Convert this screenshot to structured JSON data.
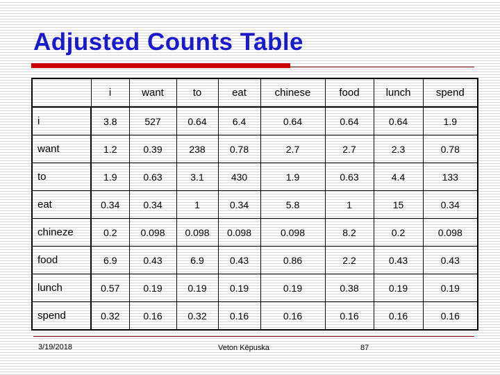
{
  "slide": {
    "title": "Adjusted Counts Table",
    "title_color": "#1A1ACC",
    "accent_bar_color": "#CC0000",
    "rule_color": "#7B1111",
    "highlight_value_color": "#1F3090"
  },
  "table": {
    "corner_header": "",
    "columns": [
      "i",
      "want",
      "to",
      "eat",
      "chinese",
      "food",
      "lunch",
      "spend"
    ],
    "rows": [
      {
        "label": "i",
        "cells": [
          {
            "value": "3.8",
            "color": "black"
          },
          {
            "value": "527",
            "color": "black"
          },
          {
            "value": "0.64",
            "color": "blue"
          },
          {
            "value": "6.4",
            "color": "black"
          },
          {
            "value": "0.64",
            "color": "blue"
          },
          {
            "value": "0.64",
            "color": "blue"
          },
          {
            "value": "0.64",
            "color": "blue"
          },
          {
            "value": "1.9",
            "color": "black"
          }
        ]
      },
      {
        "label": "want",
        "cells": [
          {
            "value": "1.2",
            "color": "black"
          },
          {
            "value": "0.39",
            "color": "blue"
          },
          {
            "value": "238",
            "color": "black"
          },
          {
            "value": "0.78",
            "color": "black"
          },
          {
            "value": "2.7",
            "color": "black"
          },
          {
            "value": "2.7",
            "color": "black"
          },
          {
            "value": "2.3",
            "color": "black"
          },
          {
            "value": "0.78",
            "color": "black"
          }
        ]
      },
      {
        "label": "to",
        "cells": [
          {
            "value": "1.9",
            "color": "black"
          },
          {
            "value": "0.63",
            "color": "blue"
          },
          {
            "value": "3.1",
            "color": "black"
          },
          {
            "value": "430",
            "color": "black"
          },
          {
            "value": "1.9",
            "color": "black"
          },
          {
            "value": "0.63",
            "color": "blue"
          },
          {
            "value": "4.4",
            "color": "black"
          },
          {
            "value": "133",
            "color": "black"
          }
        ]
      },
      {
        "label": "eat",
        "cells": [
          {
            "value": "0.34",
            "color": "blue"
          },
          {
            "value": "0.34",
            "color": "blue"
          },
          {
            "value": "1",
            "color": "black"
          },
          {
            "value": "0.34",
            "color": "blue"
          },
          {
            "value": "5.8",
            "color": "black"
          },
          {
            "value": "1",
            "color": "black"
          },
          {
            "value": "15",
            "color": "black"
          },
          {
            "value": "0.34",
            "color": "blue"
          }
        ]
      },
      {
        "label": "chineze",
        "cells": [
          {
            "value": "0.2",
            "color": "black"
          },
          {
            "value": "0.098",
            "color": "blue"
          },
          {
            "value": "0.098",
            "color": "blue"
          },
          {
            "value": "0.098",
            "color": "blue"
          },
          {
            "value": "0.098",
            "color": "blue"
          },
          {
            "value": "8.2",
            "color": "black"
          },
          {
            "value": "0.2",
            "color": "black"
          },
          {
            "value": "0.098",
            "color": "blue"
          }
        ]
      },
      {
        "label": "food",
        "cells": [
          {
            "value": "6.9",
            "color": "black"
          },
          {
            "value": "0.43",
            "color": "blue"
          },
          {
            "value": "6.9",
            "color": "black"
          },
          {
            "value": "0.43",
            "color": "blue"
          },
          {
            "value": "0.86",
            "color": "black"
          },
          {
            "value": "2.2",
            "color": "black"
          },
          {
            "value": "0.43",
            "color": "blue"
          },
          {
            "value": "0.43",
            "color": "blue"
          }
        ]
      },
      {
        "label": "lunch",
        "cells": [
          {
            "value": "0.57",
            "color": "black"
          },
          {
            "value": "0.19",
            "color": "blue"
          },
          {
            "value": "0.19",
            "color": "blue"
          },
          {
            "value": "0.19",
            "color": "blue"
          },
          {
            "value": "0.19",
            "color": "blue"
          },
          {
            "value": "0.38",
            "color": "black"
          },
          {
            "value": "0.19",
            "color": "blue"
          },
          {
            "value": "0.19",
            "color": "blue"
          }
        ]
      },
      {
        "label": "spend",
        "cells": [
          {
            "value": "0.32",
            "color": "black"
          },
          {
            "value": "0.16",
            "color": "blue"
          },
          {
            "value": "0.32",
            "color": "black"
          },
          {
            "value": "0.16",
            "color": "blue"
          },
          {
            "value": "0.16",
            "color": "blue"
          },
          {
            "value": "0.16",
            "color": "blue"
          },
          {
            "value": "0.16",
            "color": "blue"
          },
          {
            "value": "0.16",
            "color": "blue"
          }
        ]
      }
    ]
  },
  "footer": {
    "date": "3/19/2018",
    "author": "Veton Këpuska",
    "page_number": "87"
  }
}
